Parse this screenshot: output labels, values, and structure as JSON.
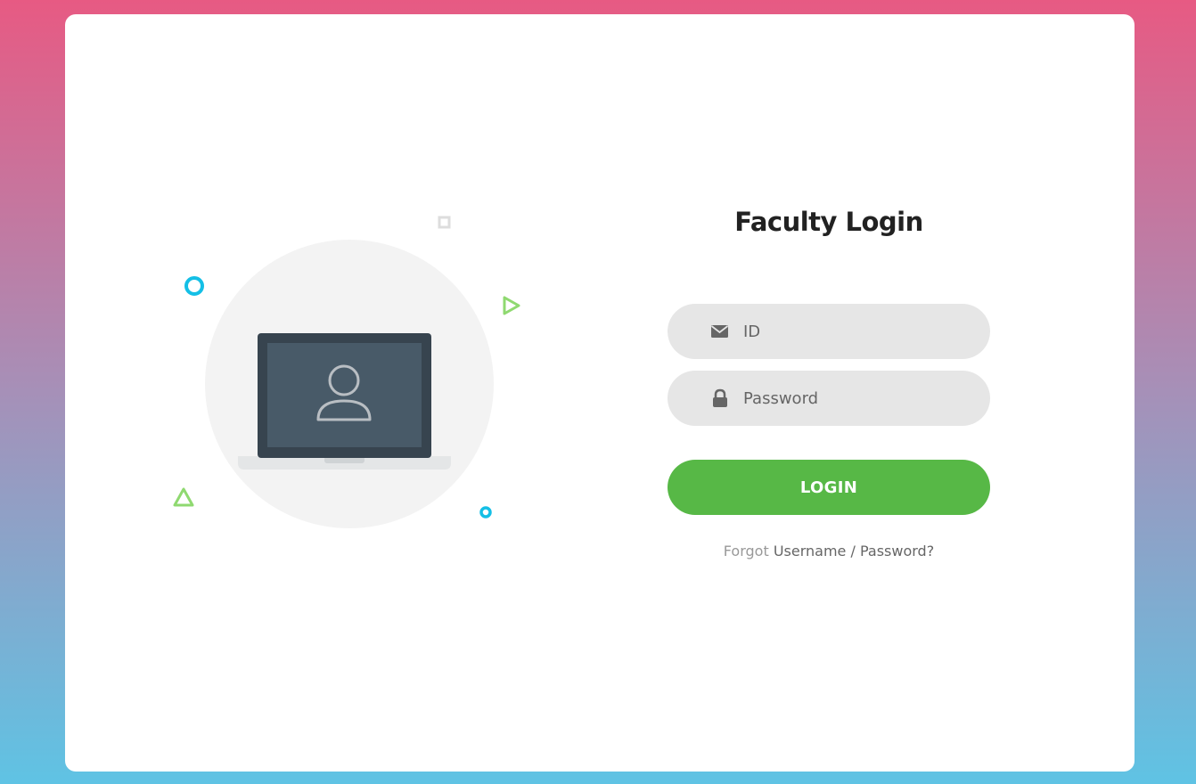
{
  "login": {
    "title": "Faculty Login",
    "id_placeholder": "ID",
    "password_placeholder": "Password",
    "button_label": "LOGIN",
    "forgot_prefix": "Forgot",
    "forgot_link": "Username / Password?"
  },
  "icons": {
    "id_field": "envelope-icon",
    "password_field": "lock-icon",
    "illustration": "laptop-user-icon"
  },
  "colors": {
    "gradient_top": "#e75a83",
    "gradient_bottom": "#5fc3e4",
    "button": "#57b846",
    "field_bg": "#e6e6e6",
    "accent_blue": "#14bfe6",
    "accent_green": "#8fd970"
  }
}
